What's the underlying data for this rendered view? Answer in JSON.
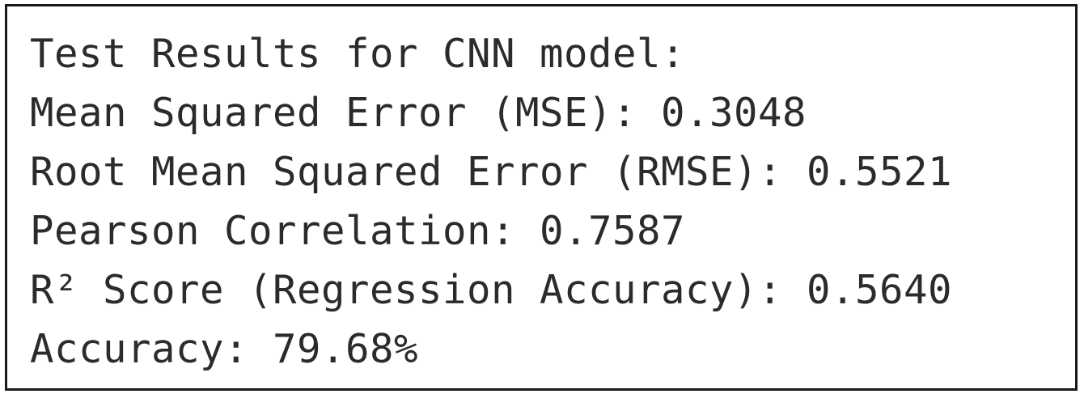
{
  "output": {
    "lines": [
      "Test Results for CNN model:",
      "Mean Squared Error (MSE): 0.3048",
      "Root Mean Squared Error (RMSE): 0.5521",
      "Pearson Correlation: 0.7587",
      "R² Score (Regression Accuracy): 0.5640",
      "Accuracy: 79.68%"
    ]
  }
}
